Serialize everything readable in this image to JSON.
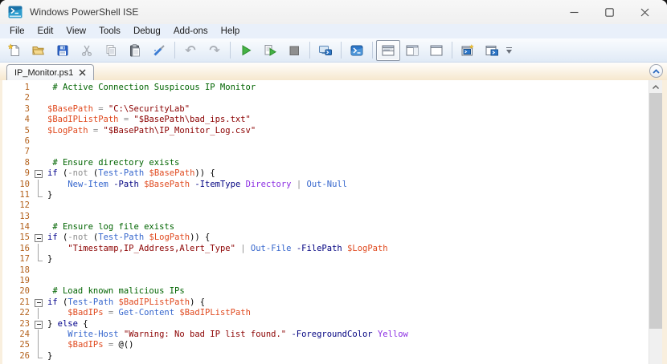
{
  "window": {
    "title": "Windows PowerShell ISE"
  },
  "menu": {
    "items": [
      "File",
      "Edit",
      "View",
      "Tools",
      "Debug",
      "Add-ons",
      "Help"
    ]
  },
  "toolbar": {
    "buttons": [
      "new-script",
      "open-script",
      "save",
      "cut",
      "copy",
      "paste",
      "clear-console-pane",
      "undo",
      "redo",
      "run-script",
      "run-selection",
      "stop-operation",
      "new-remote-powershell-tab",
      "start-powershell-exe",
      "show-script-pane-top",
      "show-script-pane-right",
      "show-script-pane-maximized",
      "new-powershell-tab",
      "show-script-pane-new-window"
    ],
    "selected_button": "show-script-pane-top",
    "undo_glyph": "↶",
    "redo_glyph": "↷"
  },
  "tab": {
    "label": "IP_Monitor.ps1"
  },
  "colors": {
    "comment": "#006400",
    "keyword": "#00008B",
    "command": "#3566CD",
    "parameter": "#000080",
    "variable": "#E04A1F",
    "string": "#8B0000",
    "operator": "#8C8C8C",
    "argument": "#8A2BE2",
    "line_number": "#B4621D",
    "run_green": "#3FA33F",
    "powershell_blue": "#2E77C9"
  },
  "editor": {
    "language": "powershell",
    "lines": [
      {
        "n": "1",
        "fold": "",
        "tokens": [
          [
            "comment",
            " # Active Connection Suspicous IP Monitor"
          ]
        ]
      },
      {
        "n": "2",
        "fold": "",
        "tokens": []
      },
      {
        "n": "3",
        "fold": "",
        "tokens": [
          [
            "var",
            "$BasePath"
          ],
          [
            "op",
            " = "
          ],
          [
            "str",
            "\"C:\\SecurityLab\""
          ]
        ]
      },
      {
        "n": "4",
        "fold": "",
        "tokens": [
          [
            "var",
            "$BadIPListPath"
          ],
          [
            "op",
            " = "
          ],
          [
            "str",
            "\"$BasePath\\bad_ips.txt\""
          ]
        ]
      },
      {
        "n": "5",
        "fold": "",
        "tokens": [
          [
            "var",
            "$LogPath"
          ],
          [
            "op",
            " = "
          ],
          [
            "str",
            "\"$BasePath\\IP_Monitor_Log.csv\""
          ]
        ]
      },
      {
        "n": "6",
        "fold": "",
        "tokens": []
      },
      {
        "n": "7",
        "fold": "",
        "tokens": []
      },
      {
        "n": "8",
        "fold": "",
        "tokens": [
          [
            "comment",
            " # Ensure directory exists"
          ]
        ]
      },
      {
        "n": "9",
        "fold": "box",
        "tokens": [
          [
            "kw",
            "if"
          ],
          [
            "plain",
            " ("
          ],
          [
            "op",
            "-not"
          ],
          [
            "plain",
            " ("
          ],
          [
            "cmd",
            "Test-Path"
          ],
          [
            "plain",
            " "
          ],
          [
            "var",
            "$BasePath"
          ],
          [
            "plain",
            ")) {"
          ]
        ]
      },
      {
        "n": "10",
        "fold": "line",
        "tokens": [
          [
            "plain",
            "    "
          ],
          [
            "cmd",
            "New-Item"
          ],
          [
            "plain",
            " "
          ],
          [
            "param",
            "-Path"
          ],
          [
            "plain",
            " "
          ],
          [
            "var",
            "$BasePath"
          ],
          [
            "plain",
            " "
          ],
          [
            "param",
            "-ItemType"
          ],
          [
            "plain",
            " "
          ],
          [
            "arg",
            "Directory"
          ],
          [
            "plain",
            " "
          ],
          [
            "op",
            "|"
          ],
          [
            "plain",
            " "
          ],
          [
            "cmd",
            "Out-Null"
          ]
        ]
      },
      {
        "n": "11",
        "fold": "end",
        "tokens": [
          [
            "plain",
            "}"
          ]
        ]
      },
      {
        "n": "12",
        "fold": "",
        "tokens": []
      },
      {
        "n": "13",
        "fold": "",
        "tokens": []
      },
      {
        "n": "14",
        "fold": "",
        "tokens": [
          [
            "comment",
            " # Ensure log file exists"
          ]
        ]
      },
      {
        "n": "15",
        "fold": "box",
        "tokens": [
          [
            "kw",
            "if"
          ],
          [
            "plain",
            " ("
          ],
          [
            "op",
            "-not"
          ],
          [
            "plain",
            " ("
          ],
          [
            "cmd",
            "Test-Path"
          ],
          [
            "plain",
            " "
          ],
          [
            "var",
            "$LogPath"
          ],
          [
            "plain",
            ")) {"
          ]
        ]
      },
      {
        "n": "16",
        "fold": "line",
        "tokens": [
          [
            "plain",
            "    "
          ],
          [
            "str",
            "\"Timestamp,IP_Address,Alert_Type\""
          ],
          [
            "plain",
            " "
          ],
          [
            "op",
            "|"
          ],
          [
            "plain",
            " "
          ],
          [
            "cmd",
            "Out-File"
          ],
          [
            "plain",
            " "
          ],
          [
            "param",
            "-FilePath"
          ],
          [
            "plain",
            " "
          ],
          [
            "var",
            "$LogPath"
          ]
        ]
      },
      {
        "n": "17",
        "fold": "end",
        "tokens": [
          [
            "plain",
            "}"
          ]
        ]
      },
      {
        "n": "18",
        "fold": "",
        "tokens": []
      },
      {
        "n": "19",
        "fold": "",
        "tokens": []
      },
      {
        "n": "20",
        "fold": "",
        "tokens": [
          [
            "comment",
            " # Load known malicious IPs"
          ]
        ]
      },
      {
        "n": "21",
        "fold": "box",
        "tokens": [
          [
            "kw",
            "if"
          ],
          [
            "plain",
            " ("
          ],
          [
            "cmd",
            "Test-Path"
          ],
          [
            "plain",
            " "
          ],
          [
            "var",
            "$BadIPListPath"
          ],
          [
            "plain",
            ") {"
          ]
        ]
      },
      {
        "n": "22",
        "fold": "line",
        "tokens": [
          [
            "plain",
            "    "
          ],
          [
            "var",
            "$BadIPs"
          ],
          [
            "op",
            " = "
          ],
          [
            "cmd",
            "Get-Content"
          ],
          [
            "plain",
            " "
          ],
          [
            "var",
            "$BadIPListPath"
          ]
        ]
      },
      {
        "n": "23",
        "fold": "box",
        "tokens": [
          [
            "plain",
            "} "
          ],
          [
            "kw",
            "else"
          ],
          [
            "plain",
            " {"
          ]
        ]
      },
      {
        "n": "24",
        "fold": "line",
        "tokens": [
          [
            "plain",
            "    "
          ],
          [
            "cmd",
            "Write-Host"
          ],
          [
            "plain",
            " "
          ],
          [
            "str",
            "\"Warning: No bad IP list found.\""
          ],
          [
            "plain",
            " "
          ],
          [
            "param",
            "-ForegroundColor"
          ],
          [
            "plain",
            " "
          ],
          [
            "arg",
            "Yellow"
          ]
        ]
      },
      {
        "n": "25",
        "fold": "line",
        "tokens": [
          [
            "plain",
            "    "
          ],
          [
            "var",
            "$BadIPs"
          ],
          [
            "op",
            " = "
          ],
          [
            "plain",
            "@()"
          ]
        ]
      },
      {
        "n": "26",
        "fold": "end",
        "tokens": [
          [
            "plain",
            "}"
          ]
        ]
      }
    ]
  }
}
